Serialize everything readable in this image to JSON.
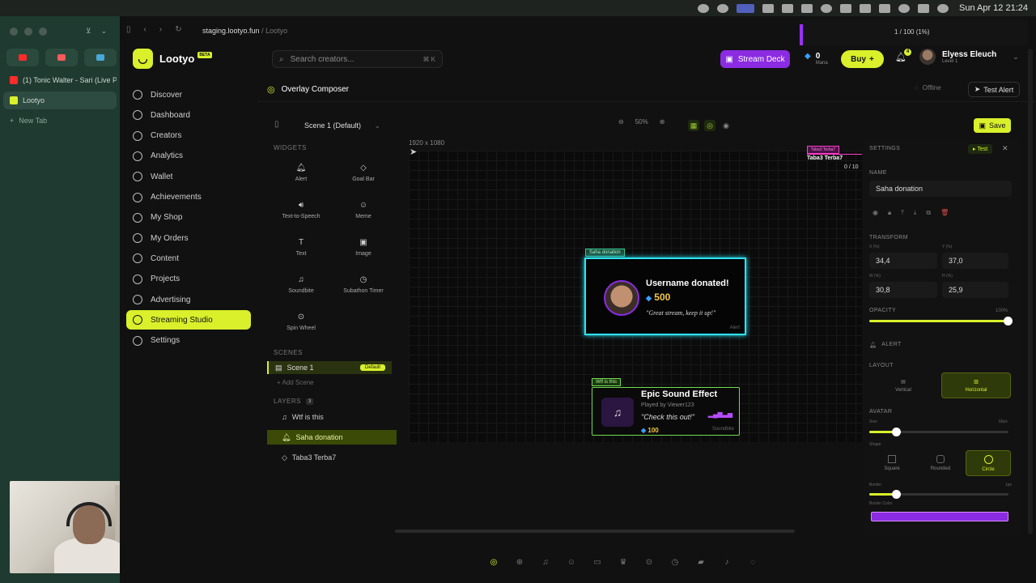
{
  "menubar": {
    "clock": "Sun Apr 12  21:24"
  },
  "browser": {
    "url_host": "staging.lootyo.fun",
    "url_path": " / Lootyo",
    "tabs": [
      {
        "label": "(1) Tonic Walter - Sari (Live P",
        "color": "#ff2b2b"
      },
      {
        "label": "Lootyo",
        "color": "#d9f02b"
      },
      {
        "label": "New Tab",
        "color": "#7a9a8c"
      }
    ]
  },
  "app": {
    "name": "Lootyo",
    "beta": "BETA",
    "search_placeholder": "Search creators...",
    "search_shortcut": "⌘ K",
    "stream_deck": "Stream Deck",
    "mana_value": "0",
    "mana_label": "Mana",
    "buy": "Buy",
    "notif_count": "4",
    "user_name": "Elyess Eleuch",
    "user_level": "Level 1",
    "progress_text": "1 / 100  (1%)",
    "progress_fraction": 0.01
  },
  "nav": [
    "Discover",
    "Dashboard",
    "Creators",
    "Analytics",
    "Wallet",
    "Achievements",
    "My Shop",
    "My Orders",
    "Content",
    "Projects",
    "Advertising",
    "Streaming Studio",
    "Settings"
  ],
  "nav_active": "Streaming Studio",
  "composer": {
    "title": "Overlay Composer",
    "status": "Offline",
    "test_alert": "Test Alert",
    "scene_select": "Scene 1 (Default)",
    "zoom": "50%",
    "save": "Save",
    "canvas_size": "1920 x 1080"
  },
  "widgets_title": "WIDGETS",
  "widgets": [
    "Alert",
    "Goal Bar",
    "Text-to-Speech",
    "Meme",
    "Text",
    "Image",
    "Soundbite",
    "Subathon Timer",
    "Spin Wheel"
  ],
  "scenes_title": "SCENES",
  "scenes": [
    {
      "name": "Scene 1",
      "tag": "Default"
    }
  ],
  "add_scene": "+ Add Scene",
  "layers_title": "LAYERS",
  "layers_count": "3",
  "layers": [
    "Wtf is this",
    "Saha donation",
    "Taba3 Terba7"
  ],
  "alert_widget": {
    "tag": "Saha donation",
    "name": "Username donated!",
    "amount": "500",
    "message": "\"Great stream, keep it up!\"",
    "label": "Alert"
  },
  "soundbite_widget": {
    "tag": "Wtf is this",
    "title": "Epic Sound Effect",
    "played_by": "Played by Viewer123",
    "message": "\"Check this out!\"",
    "amount": "100",
    "label": "Soundbite"
  },
  "goal_widget": {
    "tag": "Taba3 Terba7",
    "title": "Taba3 Terba7",
    "count": "0 / 10"
  },
  "settings": {
    "title": "SETTINGS",
    "test": "Test",
    "name_label": "NAME",
    "name_value": "Saha donation",
    "transform_label": "TRANSFORM",
    "x_label": "X (%)",
    "x_value": "34,4",
    "y_label": "Y (%)",
    "y_value": "37,0",
    "w_label": "W (%)",
    "w_value": "30,8",
    "h_label": "H (%)",
    "h_value": "25,9",
    "opacity_label": "OPACITY",
    "opacity_value": "100%",
    "opacity_fraction": 1.0,
    "alert_label": "ALERT",
    "layout_label": "LAYOUT",
    "layout_vertical": "Vertical",
    "layout_horizontal": "Horizontal",
    "avatar_label": "AVATAR",
    "size_label": "Size",
    "size_value": "66px",
    "shape_label": "Shape",
    "shape_square": "Square",
    "shape_rounded": "Rounded",
    "shape_circle": "Circle",
    "border_label": "Border",
    "border_value": "1px",
    "border_color_label": "Border Color",
    "border_color": "#8b2be2"
  },
  "colors": {
    "accent": "#d9f02b",
    "alert_border": "#2de3f5",
    "soundbite_border": "#6fdc4f"
  }
}
